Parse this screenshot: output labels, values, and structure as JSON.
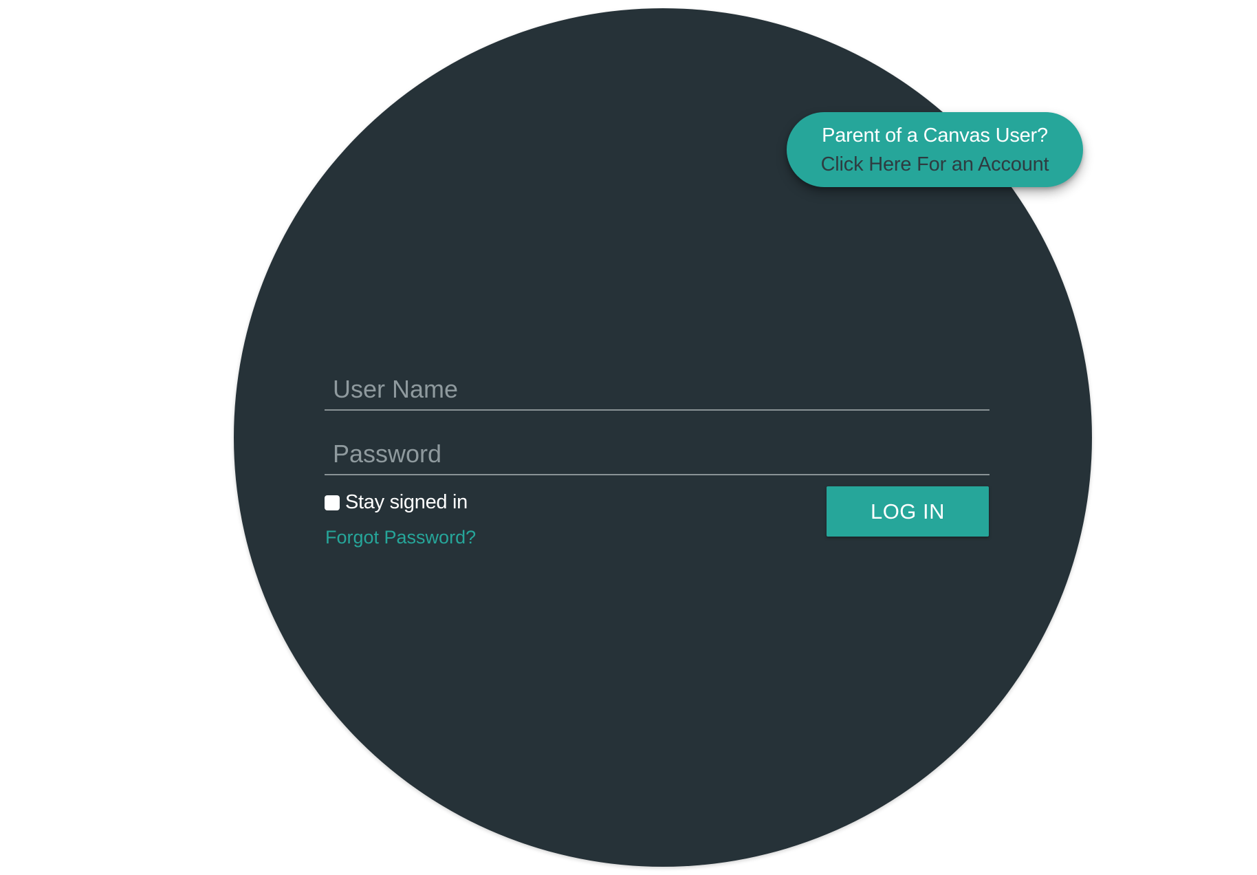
{
  "parent_banner": {
    "line1": "Parent of a Canvas User?",
    "line2": "Click Here For an Account"
  },
  "login_form": {
    "username_placeholder": "User Name",
    "username_value": "",
    "password_placeholder": "Password",
    "password_value": "",
    "stay_signed_in_label": "Stay signed in",
    "stay_signed_in_checked": false,
    "forgot_password_label": "Forgot Password?",
    "login_button_label": "LOG IN"
  },
  "colors": {
    "background": "#ffffff",
    "circle": "#263238",
    "accent": "#26a69a",
    "field_underline": "#8a9396",
    "placeholder": "#8f9a9e"
  }
}
